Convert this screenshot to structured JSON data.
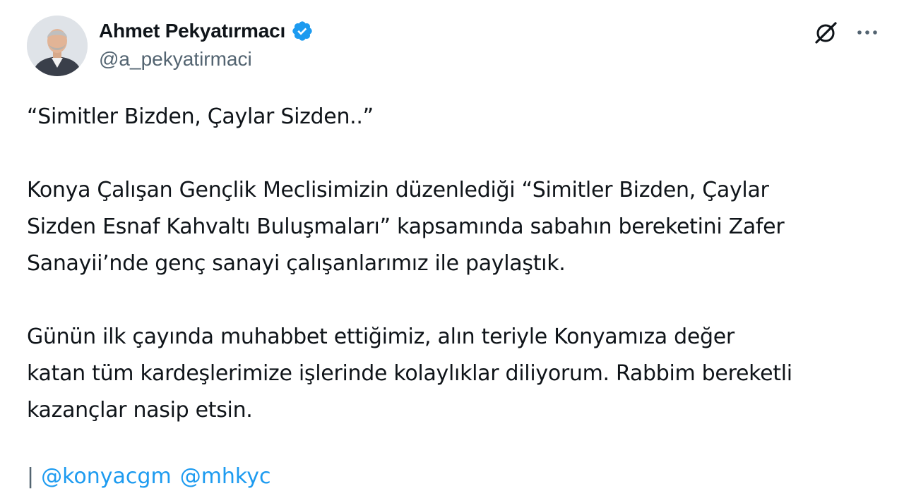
{
  "author": {
    "name": "Ahmet Pekyatırmacı",
    "handle": "@a_pekyatirmaci",
    "verified_color": "#1d9bf0"
  },
  "icons": {
    "grok": "grok-icon",
    "more": "more-horizontal-icon"
  },
  "tweet": {
    "paragraphs": [
      "“Simitler Bizden, Çaylar Sizden..”",
      "Konya Çalışan Gençlik Meclisimizin düzenlediği “Simitler Bizden, Çaylar\nSizden Esnaf Kahvaltı Buluşmaları” kapsamında sabahın bereketini Zafer\nSanayii’nde genç sanayi çalışanlarımız ile paylaştık.",
      "Günün ilk çayında muhabbet ettiğimiz, alın teriyle Konyamıza değer\nkatan tüm kardeşlerimize işlerinde kolaylıklar diliyorum. Rabbim bereketli\nkazançlar nasip etsin."
    ],
    "bar": "|",
    "mentions": [
      "@konyacgm",
      "@mhkyc"
    ]
  },
  "colors": {
    "text": "#0f1419",
    "secondary": "#536471",
    "link": "#1d9bf0"
  }
}
